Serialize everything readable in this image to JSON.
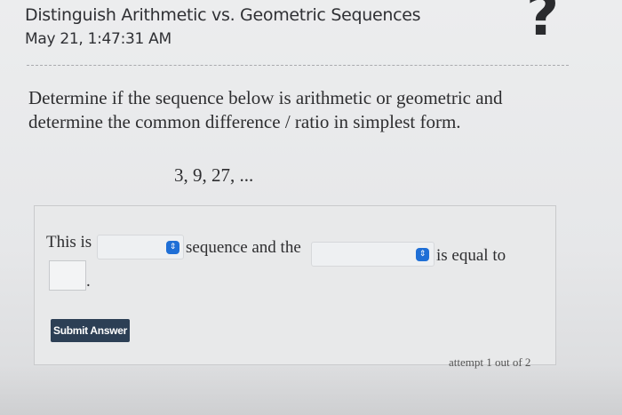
{
  "header": {
    "title": "Distinguish Arithmetic vs. Geometric Sequences",
    "datetime": "May 21, 1:47:31 AM",
    "help_icon": "?"
  },
  "question": {
    "prompt": "Determine if the sequence below is arithmetic or geometric and determine the common difference / ratio in simplest form.",
    "sequence": "3, 9, 27, ..."
  },
  "answer": {
    "prefix": "This is",
    "middle": "sequence and the",
    "suffix": "is equal to",
    "period": ".",
    "select_icon": "⇕"
  },
  "actions": {
    "submit_label": "Submit Answer"
  },
  "footer": {
    "attempt": "attempt 1 out of 2"
  },
  "colors": {
    "accent": "#1f6fd6",
    "button": "#2c3f55"
  }
}
